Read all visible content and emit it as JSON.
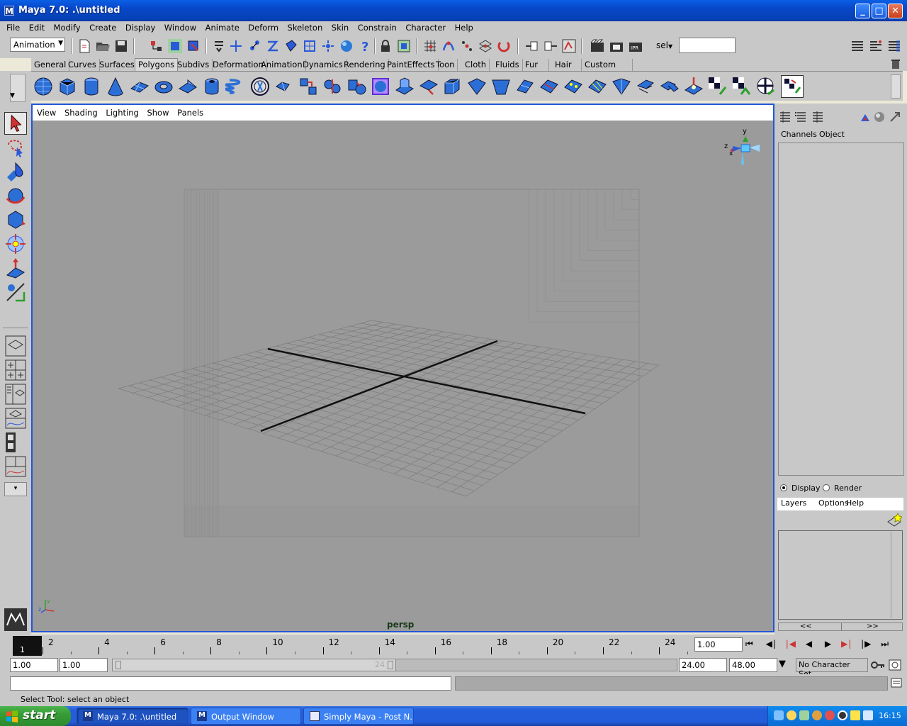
{
  "window": {
    "title": "Maya 7.0: .\\untitled",
    "app_icon": "M"
  },
  "menubar": [
    "File",
    "Edit",
    "Modify",
    "Create",
    "Display",
    "Window",
    "Animate",
    "Deform",
    "Skeleton",
    "Skin",
    "Constrain",
    "Character",
    "Help"
  ],
  "statusline": {
    "menu_set": "Animation",
    "sel_label": "sel",
    "input_value": ""
  },
  "shelf_tabs": [
    "General",
    "Curves",
    "Surfaces",
    "Polygons",
    "Subdivs",
    "Deformation",
    "Animation",
    "Dynamics",
    "Rendering",
    "PaintEffects",
    "Toon",
    "Cloth",
    "Fluids",
    "Fur",
    "Hair",
    "Custom"
  ],
  "shelf_active_tab": "Polygons",
  "viewport": {
    "menu": [
      "View",
      "Shading",
      "Lighting",
      "Show",
      "Panels"
    ],
    "camera": "persp",
    "axis_labels": {
      "x": "x",
      "y": "y",
      "z": "z"
    }
  },
  "channel_box": {
    "tabs": [
      "Channels",
      "Object"
    ]
  },
  "layer_editor": {
    "display_label": "Display",
    "render_label": "Render",
    "mode": "Display",
    "menu": [
      "Layers",
      "Options",
      "Help"
    ],
    "scroll_left": "<<",
    "scroll_right": ">>"
  },
  "time_slider": {
    "ticks": [
      "2",
      "4",
      "6",
      "8",
      "10",
      "12",
      "14",
      "16",
      "18",
      "20",
      "22",
      "24"
    ],
    "current_frame_marker": "1",
    "current_time": "1.00"
  },
  "range_slider": {
    "start_time": "1.00",
    "playback_start": "1.00",
    "range_end_label": "24",
    "playback_end": "24.00",
    "end_time": "48.00",
    "character_set": "No Character Set"
  },
  "help_line": "Select Tool: select an object",
  "taskbar": {
    "start": "start",
    "tasks": [
      "Maya 7.0: .\\untitled",
      "Output Window",
      "Simply Maya - Post N..."
    ],
    "clock": "16:15"
  },
  "colors": {
    "viewport_bg": "#9B9B9B",
    "ui_grey": "#C8C8C8",
    "active_border": "#2156D6",
    "xp_blue": "#245DDA"
  }
}
